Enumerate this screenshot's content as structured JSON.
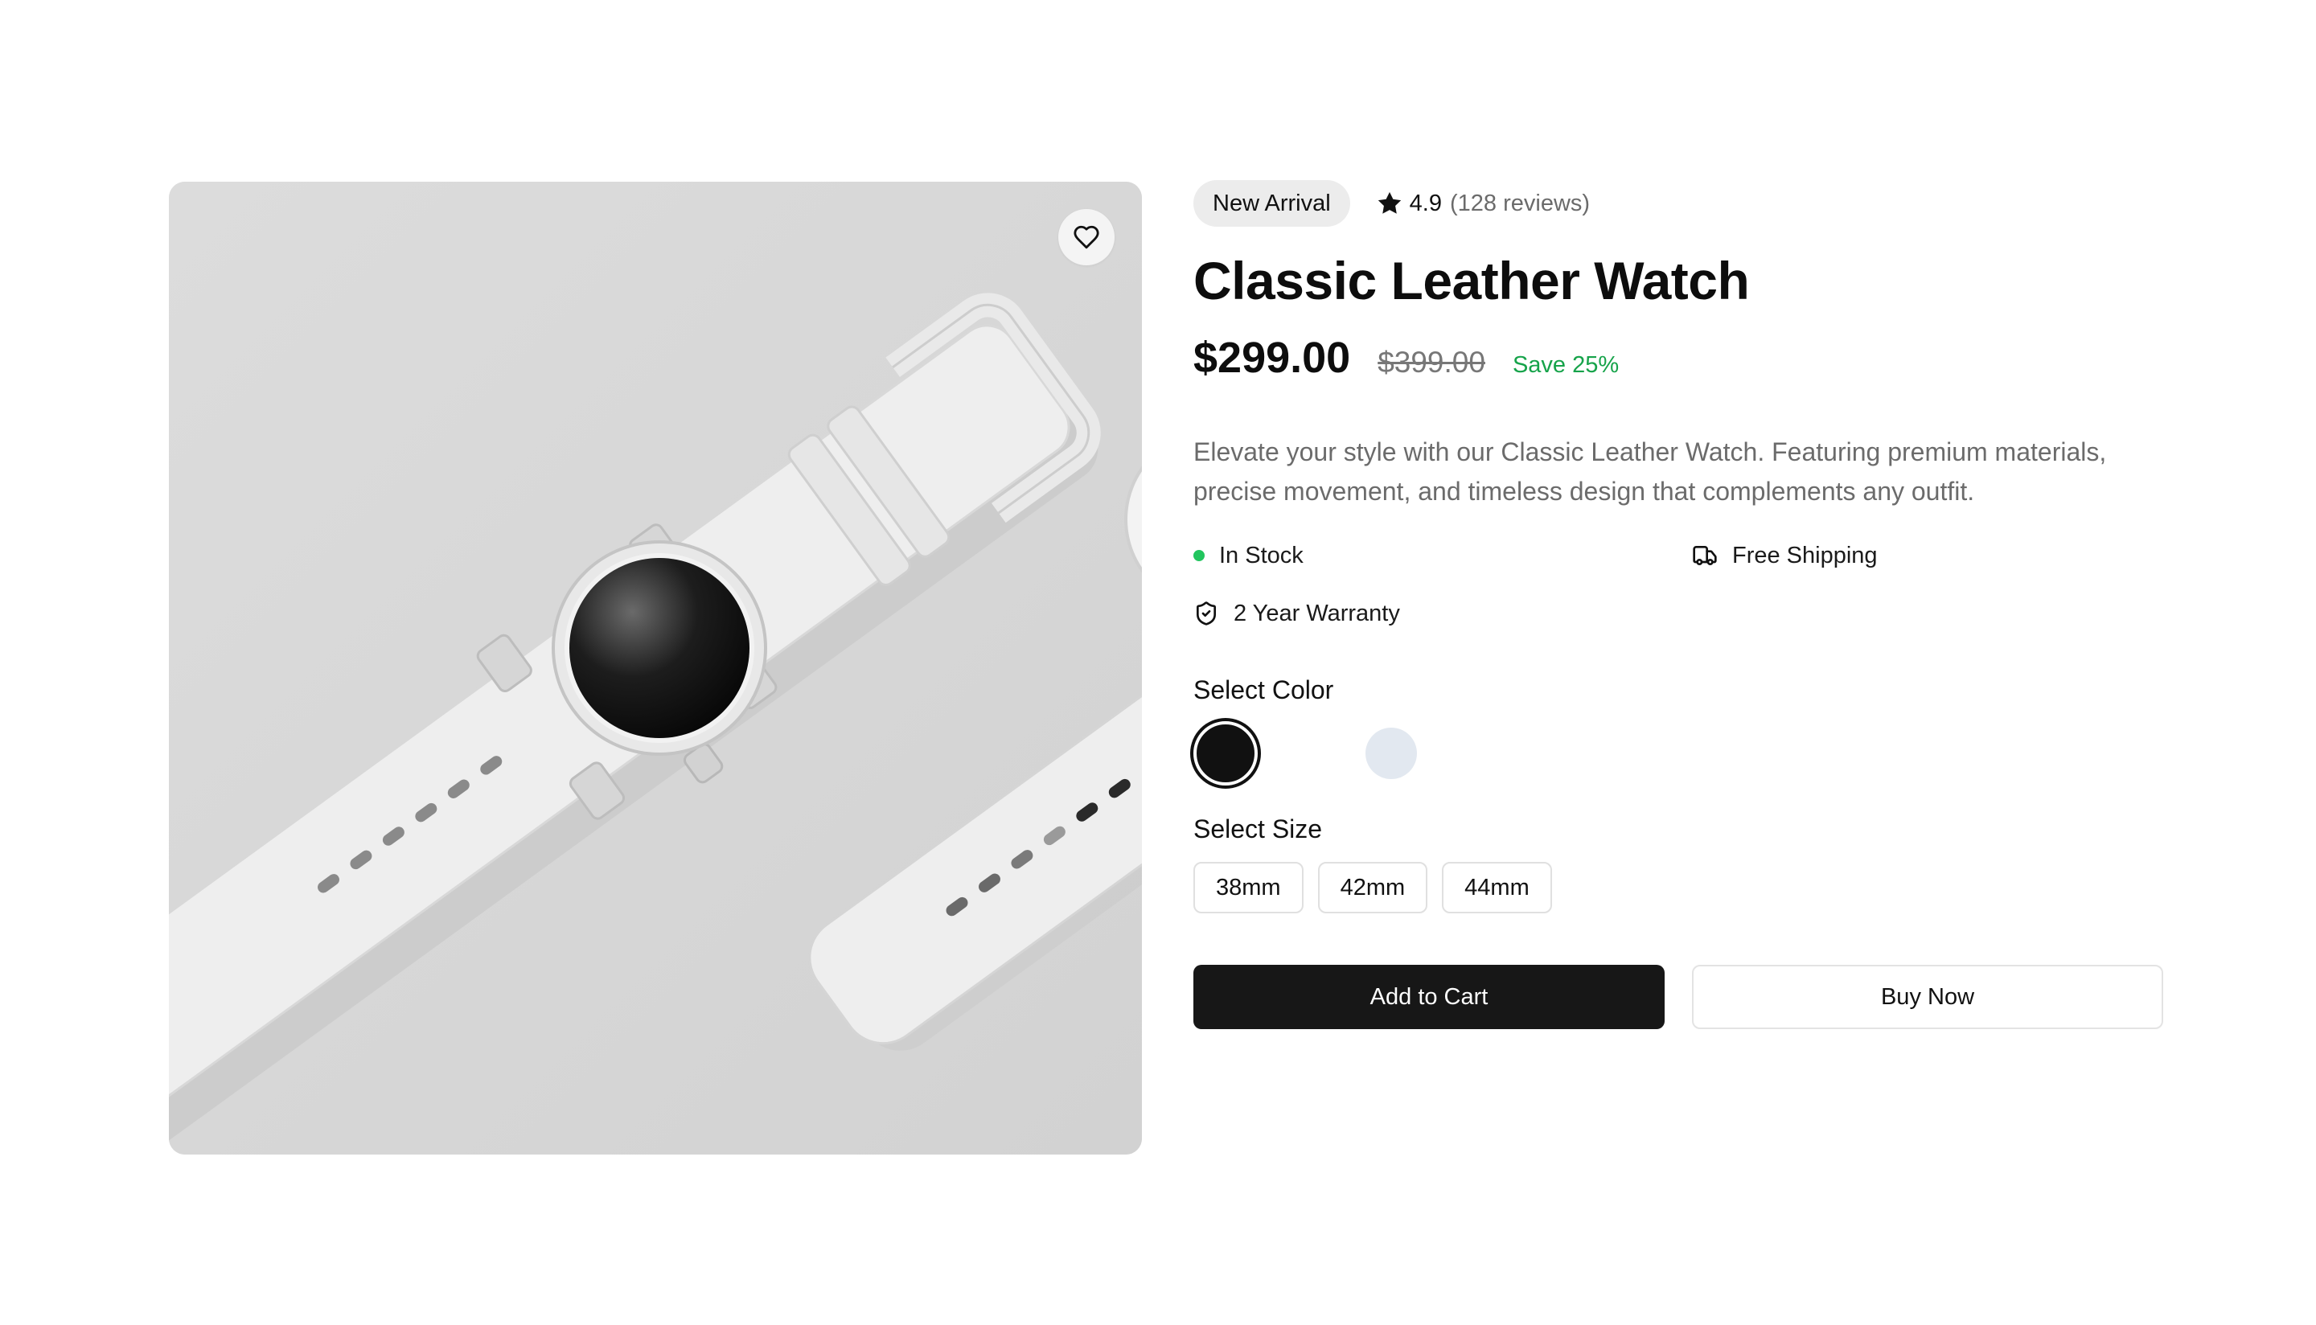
{
  "product": {
    "badge": "New Arrival",
    "rating": "4.9",
    "reviews": "(128 reviews)",
    "title": "Classic Leather Watch",
    "price": "$299.00",
    "original_price": "$399.00",
    "save_text": "Save 25%",
    "description": "Elevate your style with our Classic Leather Watch. Featuring premium materials, precise movement, and timeless design that complements any outfit.",
    "features": {
      "stock": "In Stock",
      "shipping": "Free Shipping",
      "warranty": "2 Year Warranty"
    },
    "color_label": "Select Color",
    "colors": [
      "#111111",
      "#ffffff",
      "#e2e8f0"
    ],
    "size_label": "Select Size",
    "sizes": [
      "38mm",
      "42mm",
      "44mm"
    ],
    "add_to_cart": "Add to Cart",
    "buy_now": "Buy Now"
  },
  "icons": {
    "favorite": "heart-icon",
    "rating": "star-icon",
    "stock": "status-dot",
    "shipping": "truck-icon",
    "warranty": "shield-check-icon"
  },
  "colors": {
    "accent_green": "#16a34a",
    "primary_button": "#171717",
    "image_bg": "#d9d9d9"
  }
}
